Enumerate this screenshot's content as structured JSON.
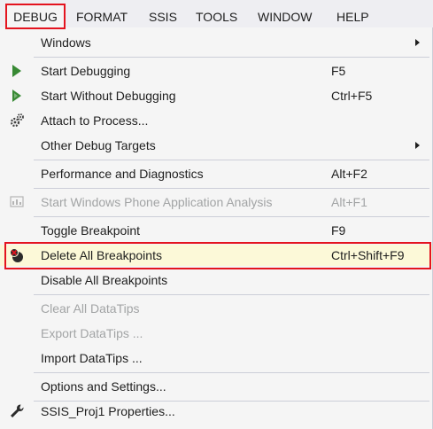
{
  "menubar": {
    "items": [
      {
        "label": "DEBUG"
      },
      {
        "label": "FORMAT"
      },
      {
        "label": "SSIS"
      },
      {
        "label": "TOOLS"
      },
      {
        "label": "WINDOW"
      },
      {
        "label": "HELP"
      }
    ]
  },
  "menu": {
    "items": [
      {
        "label": "Windows",
        "shortcut": "",
        "submenu": true
      },
      {
        "label": "Start Debugging",
        "shortcut": "F5",
        "icon": "play-icon"
      },
      {
        "label": "Start Without Debugging",
        "shortcut": "Ctrl+F5",
        "icon": "play-outline-icon"
      },
      {
        "label": "Attach to Process...",
        "shortcut": "",
        "icon": "gears-icon"
      },
      {
        "label": "Other Debug Targets",
        "shortcut": "",
        "submenu": true
      },
      {
        "label": "Performance and Diagnostics",
        "shortcut": "Alt+F2"
      },
      {
        "label": "Start Windows Phone Application Analysis",
        "shortcut": "Alt+F1",
        "icon": "phone-analysis-icon",
        "disabled": true
      },
      {
        "label": "Toggle Breakpoint",
        "shortcut": "F9"
      },
      {
        "label": "Delete All Breakpoints",
        "shortcut": "Ctrl+Shift+F9",
        "icon": "delete-breakpoints-icon",
        "highlighted": true
      },
      {
        "label": "Disable All Breakpoints",
        "shortcut": ""
      },
      {
        "label": "Clear All DataTips",
        "shortcut": "",
        "disabled": true
      },
      {
        "label": "Export DataTips ...",
        "shortcut": "",
        "disabled": true
      },
      {
        "label": "Import DataTips ...",
        "shortcut": ""
      },
      {
        "label": "Options and Settings...",
        "shortcut": ""
      },
      {
        "label": "SSIS_Proj1 Properties...",
        "shortcut": "",
        "icon": "wrench-icon"
      }
    ]
  },
  "colors": {
    "highlight": "#fcf9d8",
    "annotation_frame": "#e4141f",
    "play_green": "#388a34",
    "disabled_text": "#a2a4a5"
  }
}
